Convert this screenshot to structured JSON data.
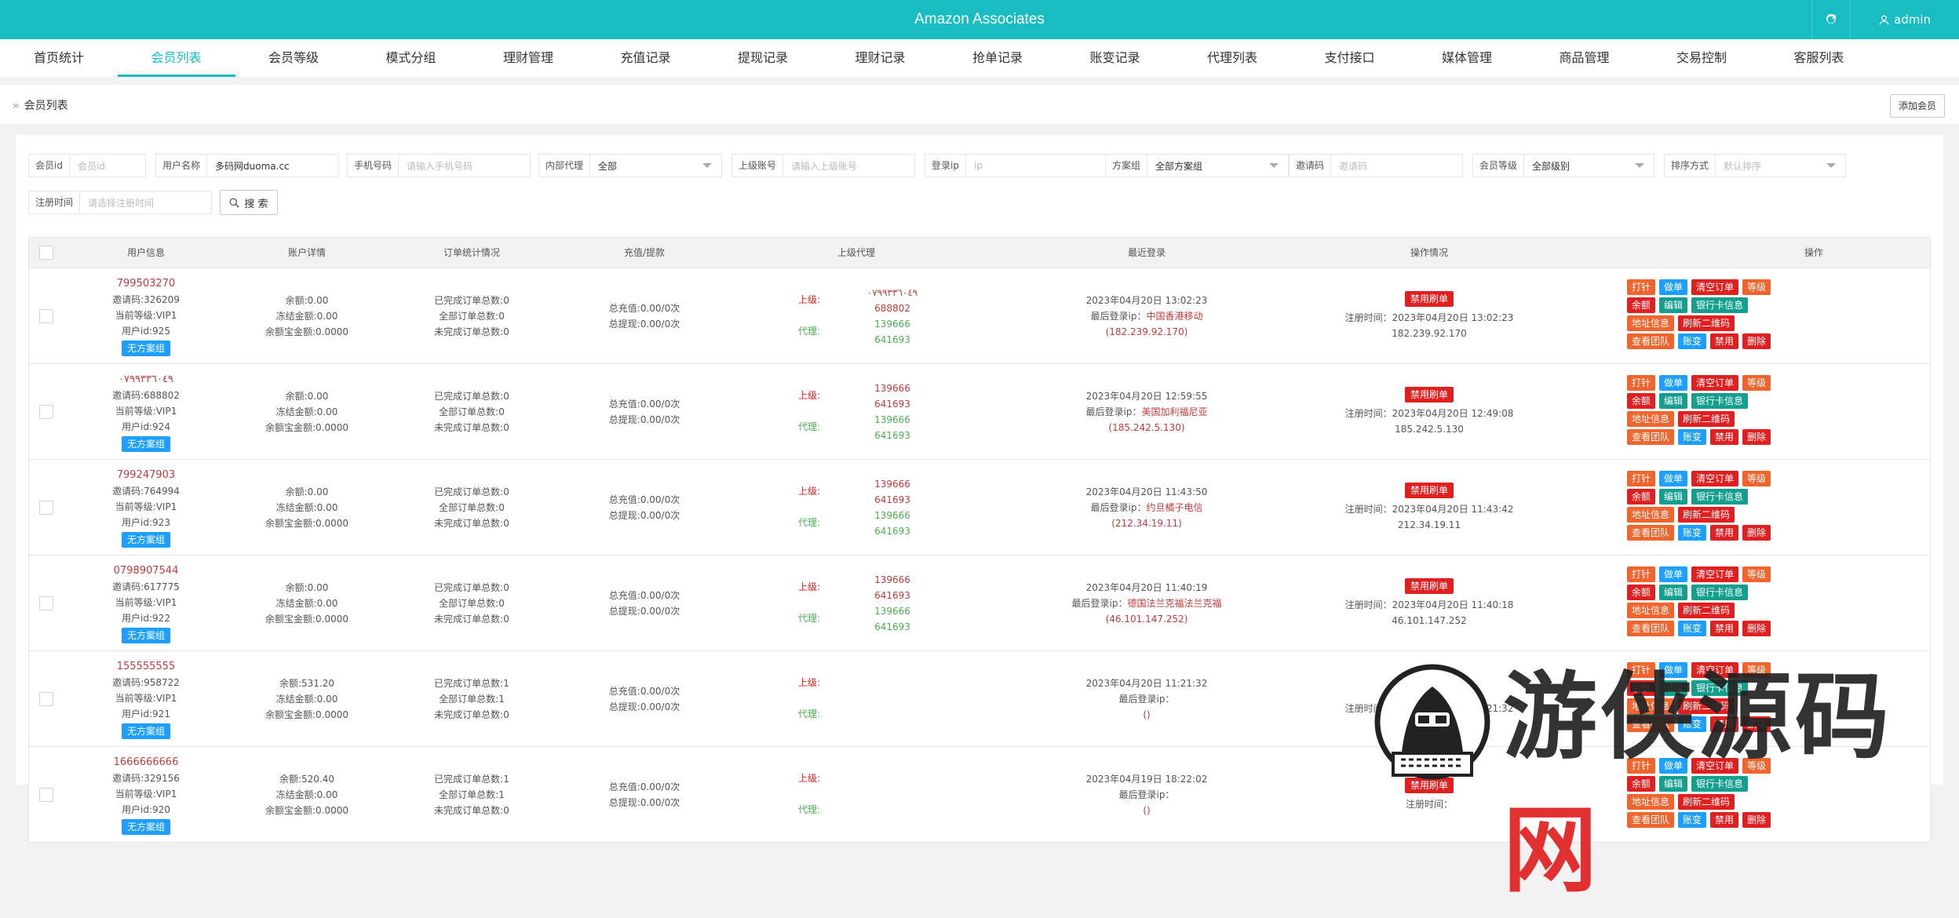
{
  "header": {
    "title": "Amazon Associates",
    "user": "admin"
  },
  "nav": [
    {
      "label": "首页统计",
      "active": false
    },
    {
      "label": "会员列表",
      "active": true
    },
    {
      "label": "会员等级",
      "active": false
    },
    {
      "label": "模式分组",
      "active": false
    },
    {
      "label": "理财管理",
      "active": false
    },
    {
      "label": "充值记录",
      "active": false
    },
    {
      "label": "提现记录",
      "active": false
    },
    {
      "label": "理财记录",
      "active": false
    },
    {
      "label": "抢单记录",
      "active": false
    },
    {
      "label": "账变记录",
      "active": false
    },
    {
      "label": "代理列表",
      "active": false
    },
    {
      "label": "支付接口",
      "active": false
    },
    {
      "label": "媒体管理",
      "active": false
    },
    {
      "label": "商品管理",
      "active": false
    },
    {
      "label": "交易控制",
      "active": false
    },
    {
      "label": "客服列表",
      "active": false
    }
  ],
  "breadcrumb": {
    "sep": "»",
    "label": "会员列表",
    "add_button": "添加会员"
  },
  "filters": {
    "member_id": {
      "label": "会员id",
      "placeholder": "会员id"
    },
    "username": {
      "label": "用户名称",
      "value": "多码网duoma.cc"
    },
    "phone": {
      "label": "手机号码",
      "placeholder": "请输入手机号码"
    },
    "internal_agent": {
      "label": "内部代理",
      "value": "全部"
    },
    "parent_account": {
      "label": "上级账号",
      "placeholder": "请输入上级账号"
    },
    "login_ip": {
      "label": "登录ip",
      "placeholder": "ip"
    },
    "plan_group": {
      "label": "方案组",
      "value": "全部方案组"
    },
    "invite_code": {
      "label": "邀请码",
      "placeholder": "邀请码"
    },
    "member_level": {
      "label": "会员等级",
      "value": "全部级别"
    },
    "sort": {
      "label": "排序方式",
      "placeholder": "默认排序"
    },
    "register_time": {
      "label": "注册时间",
      "placeholder": "请选择注册时间"
    },
    "search_button": "搜 索"
  },
  "table": {
    "headers": [
      "用户信息",
      "账户详情",
      "订单统计情况",
      "充值/提款",
      "上级代理",
      "最近登录",
      "操作情况",
      "操作"
    ],
    "labels": {
      "invite": "邀请码:",
      "level": "当前等级:",
      "uid": "用户id:",
      "balance": "余额:",
      "frozen": "冻结金额:",
      "yeb": "余额宝金额:",
      "done_orders": "已完成订单总数:",
      "all_orders": "全部订单总数:",
      "undone_orders": "未完成订单总数:",
      "total_recharge": "总充值:",
      "total_withdraw": "总提现:",
      "up": "上级:",
      "agent": "代理:",
      "last_login_ip": "最后登录ip：",
      "register_time": "注册时间：",
      "no_group": "无方案组",
      "banned": "禁用刷单"
    },
    "op_buttons": [
      {
        "label": "打针",
        "color": "orange"
      },
      {
        "label": "做单",
        "color": "blue"
      },
      {
        "label": "清空订单",
        "color": "red"
      },
      {
        "label": "等级",
        "color": "orange"
      },
      {
        "label": "余额",
        "color": "red"
      },
      {
        "label": "编辑",
        "color": "teal"
      },
      {
        "label": "银行卡信息",
        "color": "teal"
      },
      {
        "label": "地址信息",
        "color": "orange"
      },
      {
        "label": "刷新二维码",
        "color": "red"
      },
      {
        "label": "查看团队",
        "color": "orange"
      },
      {
        "label": "账变",
        "color": "blue"
      },
      {
        "label": "禁用",
        "color": "red"
      },
      {
        "label": "删除",
        "color": "red"
      }
    ],
    "rows": [
      {
        "username": "799503270",
        "invite": "326209",
        "level": "VIP1",
        "uid": "925",
        "balance": "0.00",
        "frozen": "0.00",
        "yeb": "0.0000",
        "done": "0",
        "all": "0",
        "undone": "0",
        "recharge": "0.00/0次",
        "withdraw": "0.00/0次",
        "agents_up": [
          "٠٧٩٩٣٣٦٠٤٩",
          "688802"
        ],
        "agents_agent": [
          "139666",
          "641693"
        ],
        "login_time": "2023年04月20日 13:02:23",
        "login_loc": "中国香港移动",
        "login_ip": "(182.239.92.170)",
        "reg_time": "2023年04月20日 13:02:23",
        "reg_ip": "182.239.92.170"
      },
      {
        "username": "٠٧٩٩٣٣٦٠٤٩",
        "invite": "688802",
        "level": "VIP1",
        "uid": "924",
        "balance": "0.00",
        "frozen": "0.00",
        "yeb": "0.0000",
        "done": "0",
        "all": "0",
        "undone": "0",
        "recharge": "0.00/0次",
        "withdraw": "0.00/0次",
        "agents_up": [
          "139666",
          "641693"
        ],
        "agents_agent": [
          "139666",
          "641693"
        ],
        "login_time": "2023年04月20日 12:59:55",
        "login_loc": "美国加利福尼亚",
        "login_ip": "(185.242.5.130)",
        "reg_time": "2023年04月20日 12:49:08",
        "reg_ip": "185.242.5.130"
      },
      {
        "username": "799247903",
        "invite": "764994",
        "level": "VIP1",
        "uid": "923",
        "balance": "0.00",
        "frozen": "0.00",
        "yeb": "0.0000",
        "done": "0",
        "all": "0",
        "undone": "0",
        "recharge": "0.00/0次",
        "withdraw": "0.00/0次",
        "agents_up": [
          "139666",
          "641693"
        ],
        "agents_agent": [
          "139666",
          "641693"
        ],
        "login_time": "2023年04月20日 11:43:50",
        "login_loc": "约旦橘子电信",
        "login_ip": "(212.34.19.11)",
        "reg_time": "2023年04月20日 11:43:42",
        "reg_ip": "212.34.19.11"
      },
      {
        "username": "0798907544",
        "invite": "617775",
        "level": "VIP1",
        "uid": "922",
        "balance": "0.00",
        "frozen": "0.00",
        "yeb": "0.0000",
        "done": "0",
        "all": "0",
        "undone": "0",
        "recharge": "0.00/0次",
        "withdraw": "0.00/0次",
        "agents_up": [
          "139666",
          "641693"
        ],
        "agents_agent": [
          "139666",
          "641693"
        ],
        "login_time": "2023年04月20日 11:40:19",
        "login_loc": "德国法兰克福法兰克福",
        "login_ip": "(46.101.147.252)",
        "reg_time": "2023年04月20日 11:40:18",
        "reg_ip": "46.101.147.252"
      },
      {
        "username": "155555555",
        "invite": "958722",
        "level": "VIP1",
        "uid": "921",
        "balance": "531.20",
        "frozen": "0.00",
        "yeb": "0.0000",
        "done": "1",
        "all": "1",
        "undone": "0",
        "recharge": "0.00/0次",
        "withdraw": "0.00/0次",
        "agents_up": [],
        "agents_agent": [],
        "login_time": "2023年04月20日 11:21:32",
        "login_loc": "",
        "login_ip": "()",
        "reg_time": "2023年04月20日 11:21:32",
        "reg_ip": ""
      },
      {
        "username": "1666666666",
        "invite": "329156",
        "level": "VIP1",
        "uid": "920",
        "balance": "520.40",
        "frozen": "0.00",
        "yeb": "0.0000",
        "done": "1",
        "all": "1",
        "undone": "0",
        "recharge": "0.00/0次",
        "withdraw": "0.00/0次",
        "agents_up": [],
        "agents_agent": [],
        "login_time": "2023年04月19日 18:22:02",
        "login_loc": "",
        "login_ip": "()",
        "reg_time": "",
        "reg_ip": ""
      }
    ]
  },
  "watermark": {
    "text": "游侠源码",
    "mark": "网"
  },
  "colors": {
    "primary": "#17bdc1",
    "red": "#e02020",
    "blue": "#1e9fff",
    "orange": "#f0642d",
    "teal": "#139e8e",
    "green": "#4caf50"
  }
}
